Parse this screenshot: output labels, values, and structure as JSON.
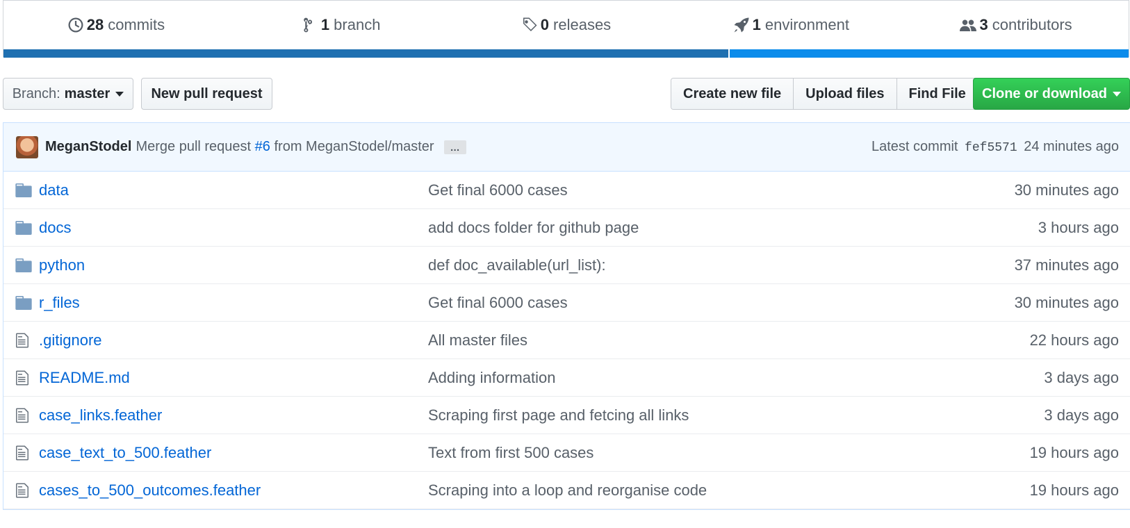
{
  "summary": {
    "commits": {
      "count": "28",
      "label": "commits",
      "icon": "history-icon"
    },
    "branches": {
      "count": "1",
      "label": "branch",
      "icon": "git-branch-icon"
    },
    "releases": {
      "count": "0",
      "label": "releases",
      "icon": "tag-icon"
    },
    "environments": {
      "count": "1",
      "label": "environment",
      "icon": "rocket-icon"
    },
    "contributors": {
      "count": "3",
      "label": "contributors",
      "icon": "people-icon"
    }
  },
  "toolbar": {
    "branch_prefix": "Branch:",
    "branch_name": "master",
    "new_pr": "New pull request",
    "create_file": "Create new file",
    "upload_files": "Upload files",
    "find_file": "Find File",
    "clone": "Clone or download"
  },
  "commit": {
    "author": "MeganStodel",
    "msg_prefix": "Merge pull request",
    "pr_link": "#6",
    "msg_suffix": "from MeganStodel/master",
    "ellipsis": "…",
    "latest_label": "Latest commit",
    "sha": "fef5571",
    "age": "24 minutes ago"
  },
  "files": [
    {
      "type": "dir",
      "name": "data",
      "message": "Get final 6000 cases",
      "age": "30 minutes ago"
    },
    {
      "type": "dir",
      "name": "docs",
      "message": "add docs folder for github page",
      "age": "3 hours ago"
    },
    {
      "type": "dir",
      "name": "python",
      "message": "def doc_available(url_list):",
      "age": "37 minutes ago"
    },
    {
      "type": "dir",
      "name": "r_files",
      "message": "Get final 6000 cases",
      "age": "30 minutes ago"
    },
    {
      "type": "file",
      "name": ".gitignore",
      "message": "All master files",
      "age": "22 hours ago"
    },
    {
      "type": "file",
      "name": "README.md",
      "message": "Adding information",
      "age": "3 days ago"
    },
    {
      "type": "file",
      "name": "case_links.feather",
      "message": "Scraping first page and fetcing all links",
      "age": "3 days ago"
    },
    {
      "type": "file",
      "name": "case_text_to_500.feather",
      "message": "Text from first 500 cases",
      "age": "19 hours ago"
    },
    {
      "type": "file",
      "name": "cases_to_500_outcomes.feather",
      "message": "Scraping into a loop and reorganise code",
      "age": "19 hours ago"
    }
  ],
  "colors": {
    "link": "#0366d6",
    "clone_green": "#28a745",
    "lang_1": "#1f70b1",
    "lang_2": "#0c8ceb"
  }
}
